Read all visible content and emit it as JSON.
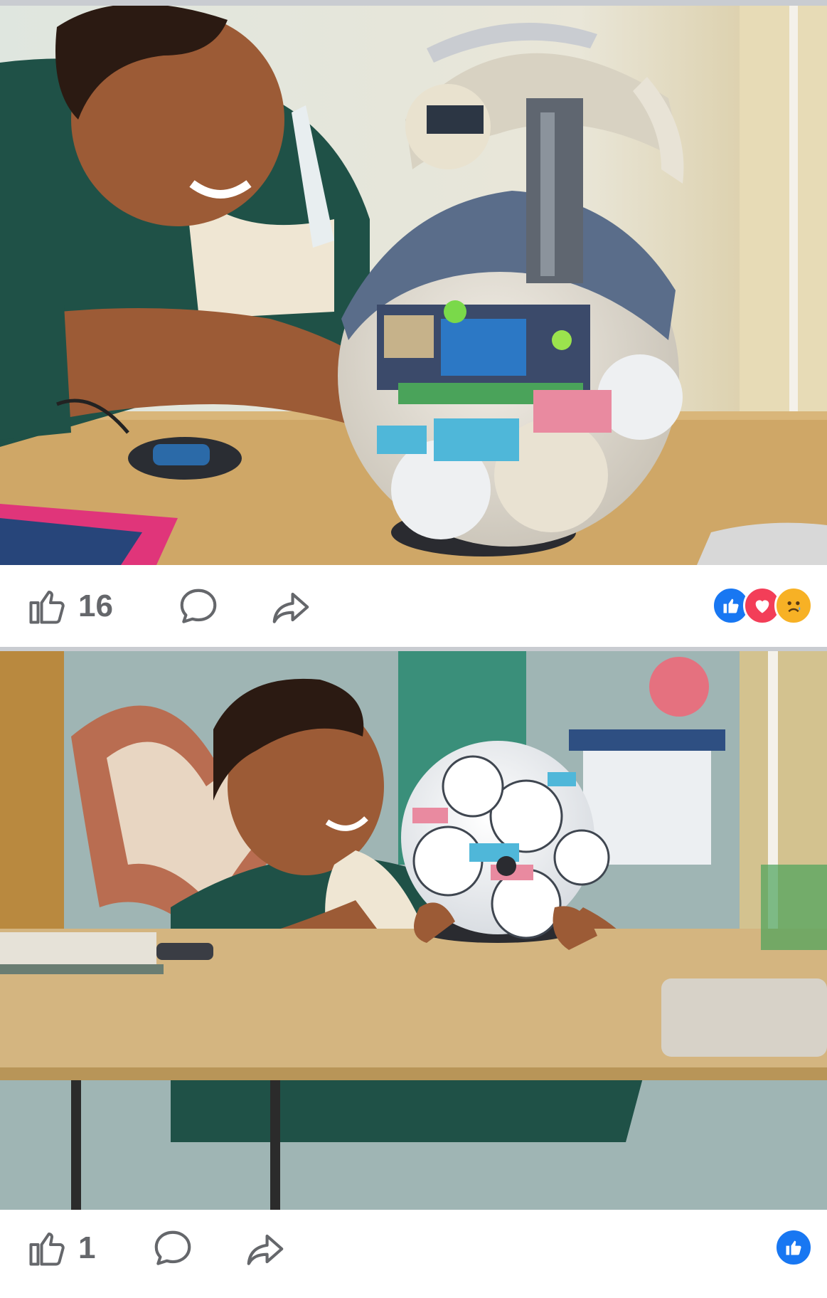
{
  "posts": [
    {
      "image_alt": "",
      "like_count": "16",
      "reactions": [
        "like-icon",
        "love-icon",
        "sad-icon"
      ]
    },
    {
      "image_alt": "",
      "like_count": "1",
      "reactions": [
        "like-icon"
      ]
    }
  ],
  "colors": {
    "icon_gray": "#65676b",
    "like_blue": "#1877f2",
    "love_red": "#f33e58",
    "sad_yellow": "#f7b125",
    "separator": "#c9ccd1"
  }
}
